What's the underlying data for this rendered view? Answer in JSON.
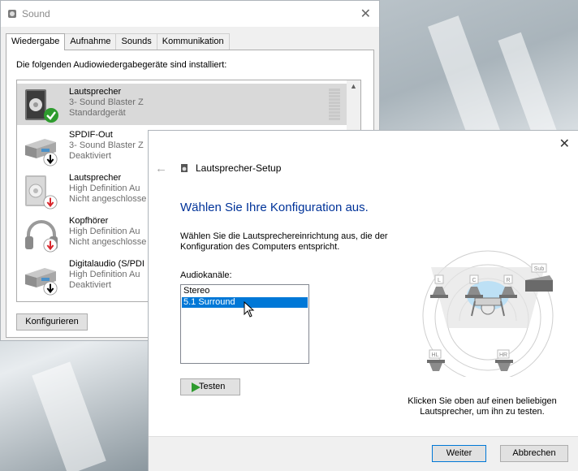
{
  "sound_dialog": {
    "title": "Sound",
    "close_glyph": "✕",
    "tabs": [
      {
        "label": "Wiedergabe",
        "active": true
      },
      {
        "label": "Aufnahme",
        "active": false
      },
      {
        "label": "Sounds",
        "active": false
      },
      {
        "label": "Kommunikation",
        "active": false
      }
    ],
    "intro_text": "Die folgenden Audiowiedergabegeräte sind installiert:",
    "devices": [
      {
        "name": "Lautsprecher",
        "description": "3- Sound Blaster Z",
        "status": "Standardgerät",
        "icon": "speaker-icon",
        "badge": "default-check-icon",
        "selected": true
      },
      {
        "name": "SPDIF-Out",
        "description": "3- Sound Blaster Z",
        "status": "Deaktiviert",
        "icon": "spdif-device-icon",
        "badge": "disabled-arrow-icon",
        "selected": false
      },
      {
        "name": "Lautsprecher",
        "description": "High Definition Au",
        "status": "Nicht angeschlosse",
        "icon": "speaker-icon",
        "badge": "unplugged-arrow-icon",
        "selected": false
      },
      {
        "name": "Kopfhörer",
        "description": "High Definition Au",
        "status": "Nicht angeschlosse",
        "icon": "headphones-icon",
        "badge": "unplugged-arrow-icon",
        "selected": false
      },
      {
        "name": "Digitalaudio (S/PDI",
        "description": "High Definition Au",
        "status": "Deaktiviert",
        "icon": "digital-audio-icon",
        "badge": "disabled-arrow-icon",
        "selected": false
      }
    ],
    "configure_button": "Konfigurieren"
  },
  "setup_dialog": {
    "title": "Lautsprecher-Setup",
    "close_glyph": "✕",
    "back_glyph": "←",
    "heading": "Wählen Sie Ihre Konfiguration aus.",
    "instruction": "Wählen Sie die Lautsprechereinrichtung aus, die der Konfiguration des Computers entspricht.",
    "channels_label": "Audiokanäle:",
    "channels": [
      {
        "label": "Stereo",
        "selected": false
      },
      {
        "label": "5.1 Surround",
        "selected": true
      }
    ],
    "test_button": "Testen",
    "speaker_labels": {
      "left": "L",
      "center": "C",
      "right": "R",
      "sub": "Sub",
      "rear_left": "HL",
      "rear_right": "HR"
    },
    "hint": "Klicken Sie oben auf einen beliebigen Lautsprecher, um ihn zu testen.",
    "next_button": "Weiter",
    "cancel_button": "Abbrechen"
  },
  "colors": {
    "heading": "#003399",
    "selection": "#0078d7",
    "accent_green": "#2e9b2e",
    "alert_red": "#d9262c"
  }
}
